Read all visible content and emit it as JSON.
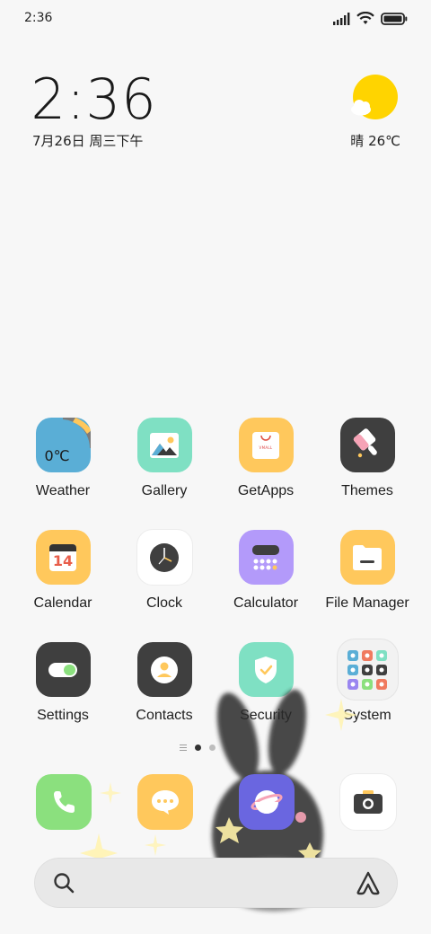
{
  "status_bar": {
    "time": "2:36"
  },
  "clock_widget": {
    "time": "2:36",
    "date": "7月26日 周三下午"
  },
  "weather_widget": {
    "text": "晴 26℃",
    "icon": "sun-behind-cloud-icon"
  },
  "apps": [
    {
      "name": "weather",
      "label": "Weather",
      "temp": "0℃"
    },
    {
      "name": "gallery",
      "label": "Gallery"
    },
    {
      "name": "getapps",
      "label": "GetApps",
      "badge": "VMALL"
    },
    {
      "name": "themes",
      "label": "Themes"
    },
    {
      "name": "calendar",
      "label": "Calendar",
      "day": "14"
    },
    {
      "name": "clock",
      "label": "Clock"
    },
    {
      "name": "calculator",
      "label": "Calculator"
    },
    {
      "name": "file-manager",
      "label": "File Manager"
    },
    {
      "name": "settings",
      "label": "Settings"
    },
    {
      "name": "contacts",
      "label": "Contacts"
    },
    {
      "name": "security",
      "label": "Security"
    },
    {
      "name": "system",
      "label": "System"
    }
  ],
  "dock": [
    {
      "name": "phone",
      "icon": "phone-icon"
    },
    {
      "name": "messages",
      "icon": "message-bubble-icon"
    },
    {
      "name": "browser",
      "icon": "planet-icon"
    },
    {
      "name": "camera",
      "icon": "camera-icon"
    }
  ],
  "page_indicator": {
    "pages": 2,
    "current": 1
  },
  "colors": {
    "weather": "#5aaed6",
    "gallery": "#7fe0c3",
    "getapps": "#ffc85c",
    "themes": "#3f3f3f",
    "calendar": "#ffc85c",
    "clock": "#ffffff",
    "calculator": "#b39afa",
    "file_manager": "#ffc85c",
    "settings": "#3f3f3f",
    "contacts": "#3f3f3f",
    "security": "#7fe0c3",
    "phone": "#8be07e",
    "messages": "#ffc85c",
    "browser": "#6a66e0",
    "camera": "#ffffff"
  }
}
